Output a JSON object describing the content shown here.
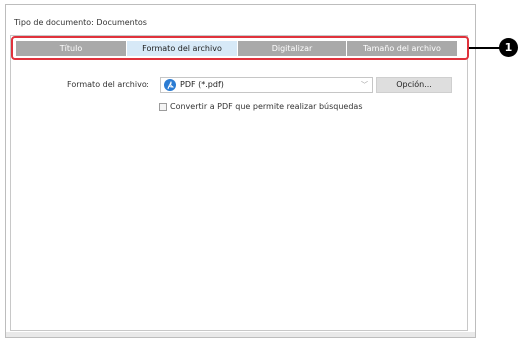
{
  "document_type_label": "Tipo de documento: Documentos",
  "tabs": [
    {
      "label": "Título",
      "active": false
    },
    {
      "label": "Formato del archivo",
      "active": true
    },
    {
      "label": "Digitalizar",
      "active": false
    },
    {
      "label": "Tamaño del archivo",
      "active": false
    }
  ],
  "callout_number": "1",
  "format": {
    "label": "Formato del archivo",
    "colon": ":",
    "selected_value": "PDF (*.pdf)",
    "icon": "pdf-icon",
    "option_button": "Opción..."
  },
  "searchable_pdf": {
    "label": "Convertir a PDF que permite realizar búsquedas",
    "checked": false
  },
  "colors": {
    "tab_inactive": "#a9a9a9",
    "tab_active": "#d7e9f7",
    "highlight": "#e0323c",
    "pdf_icon": "#2b7cd3"
  }
}
